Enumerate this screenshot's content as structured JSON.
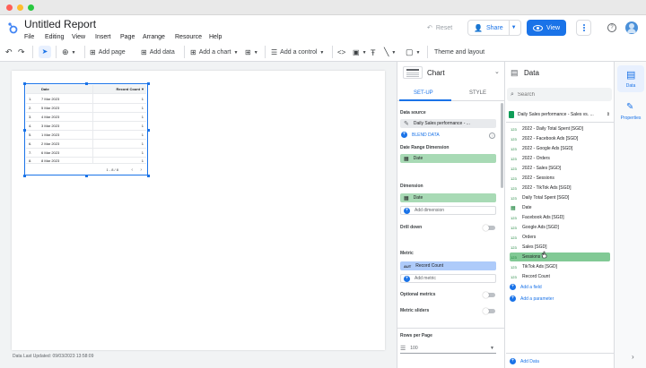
{
  "title": "Untitled Report",
  "menu": [
    "File",
    "Editing",
    "View",
    "Insert",
    "Page",
    "Arrange",
    "Resource",
    "Help"
  ],
  "header": {
    "reset": "Reset",
    "share": "Share",
    "view": "View"
  },
  "toolbar": {
    "add_page": "Add page",
    "add_data": "Add data",
    "add_chart": "Add a chart",
    "add_control": "Add a control",
    "theme": "Theme and layout"
  },
  "table": {
    "headers": [
      "Date",
      "Record Count"
    ],
    "rows": [
      [
        "7 Mar 2023",
        "1"
      ],
      [
        "5 Mar 2023",
        "1"
      ],
      [
        "4 Mar 2023",
        "1"
      ],
      [
        "3 Mar 2023",
        "1"
      ],
      [
        "1 Mar 2023",
        "1"
      ],
      [
        "2 Mar 2023",
        "1"
      ],
      [
        "6 Mar 2023",
        "1"
      ],
      [
        "8 Mar 2023",
        "1"
      ]
    ],
    "pagination": "1 - 8 / 8"
  },
  "footer": "Data Last Updated: 09/03/2023 13:58:09",
  "chart_panel": {
    "title": "Chart",
    "tabs": [
      "SET-UP",
      "STYLE"
    ],
    "data_source_label": "Data source",
    "data_source": "Daily Sales performance - ...",
    "blend": "BLEND DATA",
    "date_range_label": "Date Range Dimension",
    "date_range": "Date",
    "dimension_label": "Dimension",
    "dimension": "Date",
    "add_dimension": "Add dimension",
    "drill_down": "Drill down",
    "metric_label": "Metric",
    "metric": "Record Count",
    "metric_type": "AUT",
    "add_metric": "Add metric",
    "optional_metrics": "Optional metrics",
    "metric_sliders": "Metric sliders",
    "rows_label": "Rows per Page",
    "rows_value": "100"
  },
  "data_panel": {
    "title": "Data",
    "search_placeholder": "Search",
    "source": "Daily Sales performance - Sales vs. ...",
    "fields": [
      {
        "type": "123",
        "name": "2022 - Daily Total Spent [SGD]"
      },
      {
        "type": "123",
        "name": "2022 - Facebook Ads [SGD]"
      },
      {
        "type": "123",
        "name": "2022 - Google Ads [SGD]"
      },
      {
        "type": "123",
        "name": "2022 - Orders"
      },
      {
        "type": "123",
        "name": "2022 - Sales [SGD]"
      },
      {
        "type": "123",
        "name": "2022 - Sessions"
      },
      {
        "type": "123",
        "name": "2022 - TikTok Ads [SGD]"
      },
      {
        "type": "123",
        "name": "Daily Total Spent [SGD]"
      },
      {
        "type": "cal",
        "name": "Date"
      },
      {
        "type": "123",
        "name": "Facebook Ads [SGD]"
      },
      {
        "type": "123",
        "name": "Google Ads [SGD]"
      },
      {
        "type": "123",
        "name": "Orders"
      },
      {
        "type": "123",
        "name": "Sales [SGD]"
      },
      {
        "type": "123",
        "name": "Sessions"
      },
      {
        "type": "123",
        "name": "TikTok Ads [SGD]"
      },
      {
        "type": "123",
        "name": "Record Count"
      }
    ],
    "add_field": "Add a field",
    "add_parameter": "Add a parameter",
    "add_data": "Add Data"
  },
  "rail": {
    "data": "Data",
    "properties": "Properties"
  }
}
